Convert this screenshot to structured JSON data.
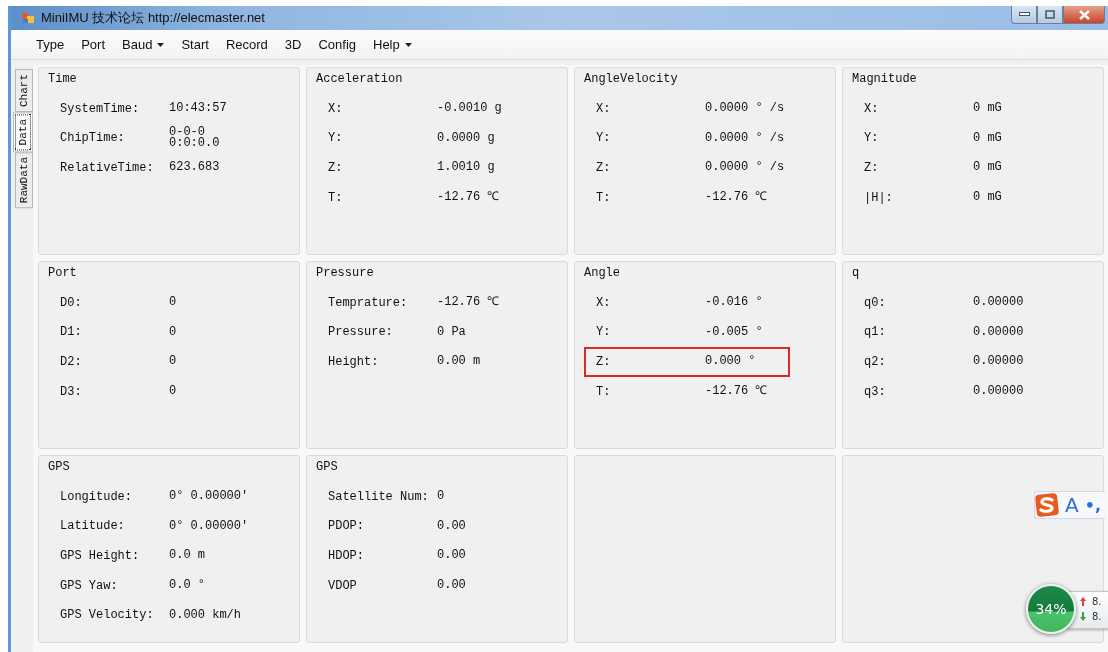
{
  "window": {
    "title": "MiniIMU 技术论坛 http://elecmaster.net"
  },
  "menu": [
    {
      "label": "Type",
      "dropdown": false
    },
    {
      "label": "Port",
      "dropdown": false
    },
    {
      "label": "Baud",
      "dropdown": true
    },
    {
      "label": "Start",
      "dropdown": false
    },
    {
      "label": "Record",
      "dropdown": false
    },
    {
      "label": "3D",
      "dropdown": false
    },
    {
      "label": "Config",
      "dropdown": false
    },
    {
      "label": "Help",
      "dropdown": true
    }
  ],
  "side_tabs": [
    {
      "label": "Chart",
      "selected": false
    },
    {
      "label": "Data",
      "selected": true
    },
    {
      "label": "RawData",
      "selected": false
    }
  ],
  "groups": [
    {
      "kind": "values",
      "title": "Time",
      "rows": [
        {
          "label": "SystemTime:",
          "value": "10:43:57",
          "highlighted": false
        },
        {
          "label": "ChipTime:",
          "value": "0-0-0\n0:0:0.0",
          "highlighted": false
        },
        {
          "label": "RelativeTime:",
          "value": "623.683",
          "highlighted": false
        }
      ]
    },
    {
      "kind": "values",
      "title": "Acceleration",
      "rows": [
        {
          "label": "X:",
          "value": "-0.0010 g",
          "highlighted": false
        },
        {
          "label": "Y:",
          "value": "0.0000 g",
          "highlighted": false
        },
        {
          "label": "Z:",
          "value": "1.0010 g",
          "highlighted": false
        },
        {
          "label": "T:",
          "value": "-12.76 ℃",
          "highlighted": false
        }
      ]
    },
    {
      "kind": "values",
      "title": "AngleVelocity",
      "rows": [
        {
          "label": "X:",
          "value": "0.0000 ° /s",
          "highlighted": false
        },
        {
          "label": "Y:",
          "value": "0.0000 ° /s",
          "highlighted": false
        },
        {
          "label": "Z:",
          "value": "0.0000 ° /s",
          "highlighted": false
        },
        {
          "label": "T:",
          "value": "-12.76 ℃",
          "highlighted": false
        }
      ]
    },
    {
      "kind": "values",
      "title": "Magnitude",
      "rows": [
        {
          "label": "X:",
          "value": "0 mG",
          "highlighted": false
        },
        {
          "label": "Y:",
          "value": "0 mG",
          "highlighted": false
        },
        {
          "label": "Z:",
          "value": "0 mG",
          "highlighted": false
        },
        {
          "label": "|H|:",
          "value": "0 mG",
          "highlighted": false
        }
      ]
    },
    {
      "kind": "values",
      "title": "Port",
      "rows": [
        {
          "label": "D0:",
          "value": "0",
          "highlighted": false
        },
        {
          "label": "D1:",
          "value": "0",
          "highlighted": false
        },
        {
          "label": "D2:",
          "value": "0",
          "highlighted": false
        },
        {
          "label": "D3:",
          "value": "0",
          "highlighted": false
        }
      ]
    },
    {
      "kind": "values",
      "title": "Pressure",
      "rows": [
        {
          "label": "Temprature:",
          "value": "-12.76 ℃",
          "highlighted": false
        },
        {
          "label": "Pressure:",
          "value": "0 Pa",
          "highlighted": false
        },
        {
          "label": "Height:",
          "value": "0.00 m",
          "highlighted": false
        }
      ]
    },
    {
      "kind": "values",
      "title": "Angle",
      "rows": [
        {
          "label": "X:",
          "value": "-0.016 °",
          "highlighted": false
        },
        {
          "label": "Y:",
          "value": "-0.005 °",
          "highlighted": false
        },
        {
          "label": "Z:",
          "value": "0.000 °",
          "highlighted": true
        },
        {
          "label": "T:",
          "value": "-12.76 ℃",
          "highlighted": false
        }
      ]
    },
    {
      "kind": "values",
      "title": "q",
      "rows": [
        {
          "label": "q0:",
          "value": "0.00000",
          "highlighted": false
        },
        {
          "label": "q1:",
          "value": "0.00000",
          "highlighted": false
        },
        {
          "label": "q2:",
          "value": "0.00000",
          "highlighted": false
        },
        {
          "label": "q3:",
          "value": "0.00000",
          "highlighted": false
        }
      ]
    },
    {
      "kind": "values",
      "title": "GPS",
      "rows": [
        {
          "label": "Longitude:",
          "value": "0° 0.00000′",
          "highlighted": false
        },
        {
          "label": "Latitude:",
          "value": "0° 0.00000′",
          "highlighted": false
        },
        {
          "label": "GPS Height:",
          "value": "0.0 m",
          "highlighted": false
        },
        {
          "label": "GPS Yaw:",
          "value": "0.0 °",
          "highlighted": false
        },
        {
          "label": "GPS Velocity:",
          "value": "0.000 km/h",
          "highlighted": false
        }
      ]
    },
    {
      "kind": "values",
      "title": "GPS",
      "rows": [
        {
          "label": "Satellite Num:",
          "value": "0",
          "highlighted": false
        },
        {
          "label": "PDOP:",
          "value": "0.00",
          "highlighted": false
        },
        {
          "label": "HDOP:",
          "value": "0.00",
          "highlighted": false
        },
        {
          "label": "VDOP",
          "value": "0.00",
          "highlighted": false
        }
      ]
    },
    {
      "kind": "empty"
    },
    {
      "kind": "empty"
    }
  ],
  "ime_toolbar": {
    "mode": "A",
    "punctuation": "•,"
  },
  "net_widget": {
    "percent": "34%",
    "upload": "8.",
    "download": "8."
  }
}
